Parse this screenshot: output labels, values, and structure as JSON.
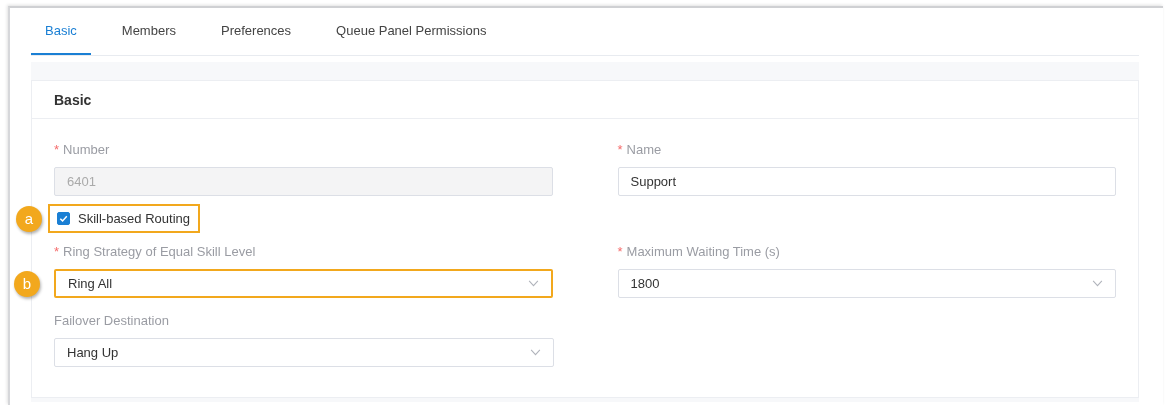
{
  "tabs": [
    {
      "label": "Basic",
      "selected": true
    },
    {
      "label": "Members",
      "selected": false
    },
    {
      "label": "Preferences",
      "selected": false
    },
    {
      "label": "Queue Panel Permissions",
      "selected": false
    }
  ],
  "section": {
    "title": "Basic",
    "rows": [
      [
        {
          "kind": "text",
          "label": "Number",
          "required_mark": "*",
          "value": "6401",
          "disabled": true
        },
        {
          "kind": "text",
          "label": "Name",
          "required_mark": "*",
          "value": "Support",
          "disabled": false
        }
      ],
      [
        {
          "kind": "checkbox",
          "label": "Skill-based Routing",
          "checked": true,
          "callout": "a"
        }
      ],
      [
        {
          "kind": "select",
          "label": "Ring Strategy of Equal Skill Level",
          "required_mark": "*",
          "value": "Ring All",
          "callout": "b"
        },
        {
          "kind": "select",
          "label": "Maximum Waiting Time (s)",
          "required_mark": "*",
          "value": "1800"
        }
      ],
      [
        {
          "kind": "select",
          "label": "Failover Destination",
          "value": "Hang Up"
        }
      ]
    ]
  }
}
